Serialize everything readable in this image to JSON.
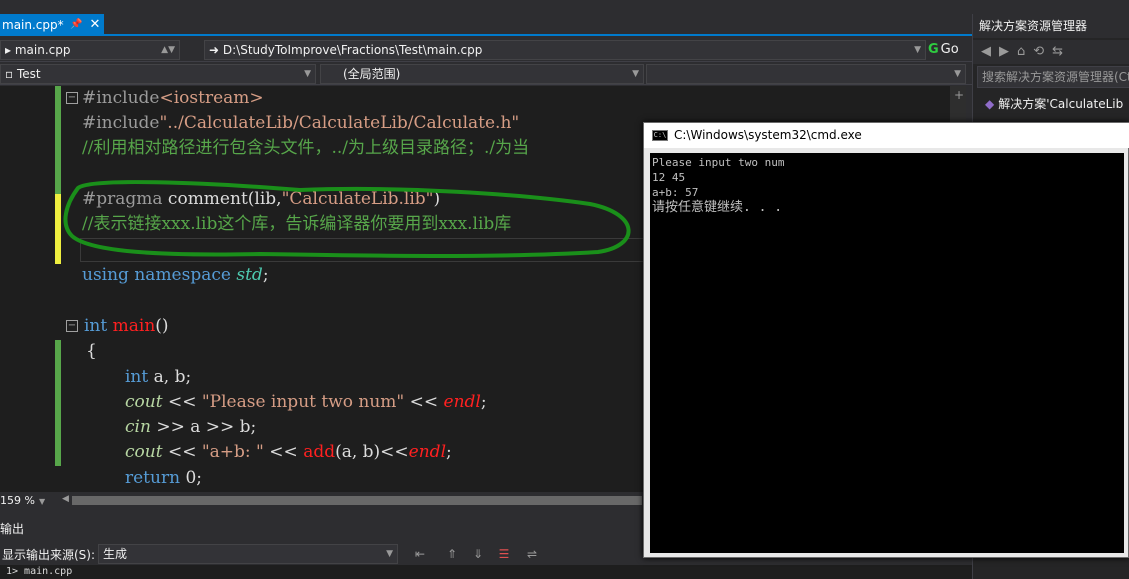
{
  "tab": {
    "title": "main.cpp*"
  },
  "nav": {
    "file_combo": "main.cpp",
    "path": "D:\\StudyToImprove\\Fractions\\Test\\main.cpp",
    "go_label": "Go",
    "project_combo": "Test",
    "scope_combo": "(全局范围)"
  },
  "code": {
    "l1_a": "#include",
    "l1_b": "<iostream>",
    "l2_a": "#include",
    "l2_b": "\"../CalculateLib/CalculateLib/Calculate.h\"",
    "l3": "//利用相对路径进行包含头文件，../为上级目录路径；./为当",
    "l5_a": "#pragma",
    "l5_b": " comment(lib,",
    "l5_c": "\"CalculateLib.lib\"",
    "l5_d": ")",
    "l6": "//表示链接xxx.lib这个库，告诉编译器你要用到xxx.lib库",
    "l8_a": "using",
    "l8_b": " namespace ",
    "l8_c": "std",
    "l8_d": ";",
    "l10_a": "int",
    "l10_b": " main",
    "l10_c": "()",
    "l11": "{",
    "l12_a": "int",
    "l12_b": " a, b;",
    "l13_a": "cout",
    "l13_b": " << ",
    "l13_c": "\"Please input two num\"",
    "l13_d": " << ",
    "l13_e": "endl",
    "l13_f": ";",
    "l14_a": "cin",
    "l14_b": " >> a >> b;",
    "l15_a": "cout",
    "l15_b": " << ",
    "l15_c": "\"a+b: \"",
    "l15_d": " << ",
    "l15_e": "add",
    "l15_f": "(a, b)<<",
    "l15_g": "endl",
    "l15_h": ";",
    "l16_a": "return",
    "l16_b": " 0;"
  },
  "status": {
    "zoom": "159 %"
  },
  "output": {
    "header": "输出",
    "source_label": "显示输出来源(S):",
    "source_value": "生成",
    "text": "1>  main.cpp"
  },
  "solution_explorer": {
    "title": "解决方案资源管理器",
    "search_placeholder": "搜索解决方案资源管理器(Ct",
    "root_item": "解决方案'CalculateLib"
  },
  "console": {
    "title": "C:\\Windows\\system32\\cmd.exe",
    "lines": [
      "Please input two num",
      "12 45",
      "a+b: 57",
      "请按任意键继续. . ."
    ]
  },
  "colors": {
    "accent": "#007acc",
    "annotation": "#1a8f1a"
  }
}
